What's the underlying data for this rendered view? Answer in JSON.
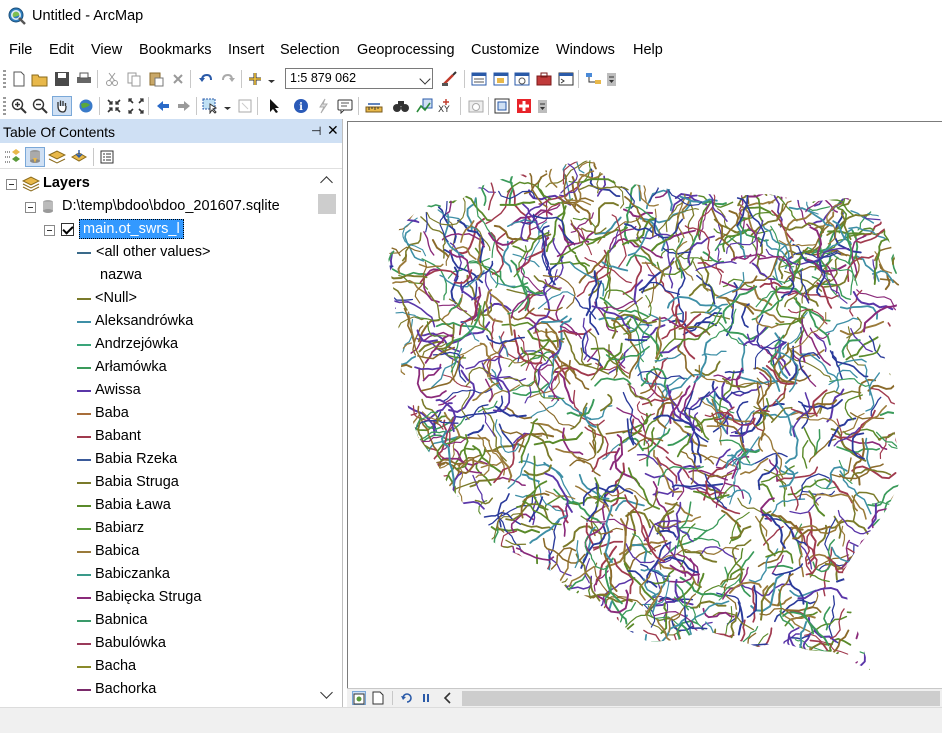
{
  "window": {
    "title": "Untitled - ArcMap",
    "app_icon": "arcmap-globe-icon"
  },
  "menu": [
    "File",
    "Edit",
    "View",
    "Bookmarks",
    "Insert",
    "Selection",
    "Geoprocessing",
    "Customize",
    "Windows",
    "Help"
  ],
  "standard_toolbar": {
    "scale": "1:5 879 062",
    "icons": [
      "new-document-icon",
      "open-icon",
      "save-icon",
      "print-icon",
      "cut-icon",
      "copy-icon",
      "paste-icon",
      "delete-icon",
      "undo-icon",
      "redo-icon",
      "add-data-icon",
      "editor-toolbar-icon",
      "table-of-contents-icon",
      "catalog-icon",
      "search-window-icon",
      "arctoolbox-icon",
      "python-window-icon",
      "model-builder-icon"
    ]
  },
  "tools_toolbar": {
    "icons": [
      "zoom-in-icon",
      "zoom-out-icon",
      "pan-icon",
      "full-extent-icon",
      "fixed-zoom-in-icon",
      "fixed-zoom-out-icon",
      "back-extent-icon",
      "forward-extent-icon",
      "select-features-icon",
      "clear-selection-icon",
      "select-elements-icon",
      "identify-icon",
      "hyperlink-icon",
      "html-popup-icon",
      "measure-icon",
      "find-icon",
      "find-route-icon",
      "go-to-xy-icon",
      "time-slider-icon",
      "create-viewer-window-icon",
      "swipe-icon"
    ]
  },
  "toc": {
    "title": "Table Of Contents",
    "pin_glyph": "⊣",
    "close_glyph": "✕",
    "tool_icons": [
      "list-by-drawing-order-icon",
      "list-by-source-icon",
      "list-by-visibility-icon",
      "list-by-selection-icon",
      "options-icon"
    ],
    "data_frame": "Layers",
    "source": "D:\\temp\\bdoo\\bdoo_201607.sqlite",
    "layer": "main.ot_swrs_l",
    "all_other": "<all other values>",
    "field_header": "nazwa",
    "entries": [
      {
        "label": "<Null>",
        "color": "#7a7a2a"
      },
      {
        "label": "Aleksandrówka",
        "color": "#3e8fa6"
      },
      {
        "label": "Andrzejówka",
        "color": "#3aa57a"
      },
      {
        "label": "Arłamówka",
        "color": "#3a9a5a"
      },
      {
        "label": "Awissa",
        "color": "#5a36a8"
      },
      {
        "label": "Baba",
        "color": "#a86e3a"
      },
      {
        "label": "Babant",
        "color": "#a03a4e"
      },
      {
        "label": "Babia Rzeka",
        "color": "#3a5a9a"
      },
      {
        "label": "Babia Struga",
        "color": "#7a7a2a"
      },
      {
        "label": "Babia Ława",
        "color": "#5a8a2a"
      },
      {
        "label": "Babiarz",
        "color": "#5a9a3a"
      },
      {
        "label": "Babica",
        "color": "#9a7a3a"
      },
      {
        "label": "Babiczanka",
        "color": "#3a9a8a"
      },
      {
        "label": "Babięcka Struga",
        "color": "#8a2a7a"
      },
      {
        "label": "Babnica",
        "color": "#3a9a6a"
      },
      {
        "label": "Babulówka",
        "color": "#9a3a5a"
      },
      {
        "label": "Bacha",
        "color": "#8a8a2a"
      },
      {
        "label": "Bachorka",
        "color": "#7a2a6a"
      }
    ]
  },
  "map": {
    "line_colors": [
      "#7a7a2a",
      "#5a36a8",
      "#3a9a5a",
      "#a03a4e",
      "#3e8fa6",
      "#8a6a2a",
      "#5a8a2a",
      "#2a3a9a",
      "#9a7a3a",
      "#8a2a7a"
    ]
  },
  "map_footer_icons": [
    "data-view-icon",
    "layout-view-icon",
    "refresh-icon",
    "pause-drawing-icon",
    "scroll-left-icon"
  ]
}
